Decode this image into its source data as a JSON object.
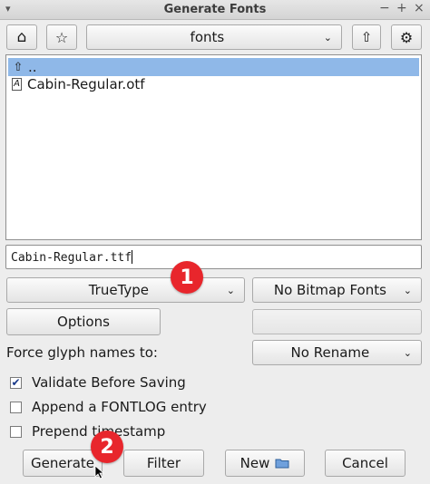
{
  "window": {
    "title": "Generate Fonts",
    "menu_glyph": "▾",
    "min_glyph": "−",
    "max_glyph": "+",
    "close_glyph": "×"
  },
  "toolbar": {
    "home_icon": "⌂",
    "star_icon": "☆",
    "folder_combo": "fonts",
    "up_icon": "⇧",
    "gear_icon": "⚙"
  },
  "files": [
    {
      "icon": "⇧",
      "name": "..",
      "selected": true
    },
    {
      "icon": "A",
      "name": "Cabin-Regular.otf",
      "selected": false
    }
  ],
  "filename_value": "Cabin-Regular.ttf",
  "format_combo": "TrueType",
  "bitmap_combo": "No Bitmap Fonts",
  "options_button": "Options",
  "force_label": "Force glyph names to:",
  "rename_combo": "No Rename",
  "checkboxes": [
    {
      "label": "Validate Before Saving",
      "checked": true,
      "mark": "✔"
    },
    {
      "label": "Append a FONTLOG entry",
      "checked": false,
      "mark": ""
    },
    {
      "label": "Prepend timestamp",
      "checked": false,
      "mark": ""
    }
  ],
  "buttons": {
    "generate": "Generate",
    "filter": "Filter",
    "new": "New",
    "cancel": "Cancel"
  },
  "annotations": [
    "1",
    "2"
  ],
  "arrow_glyph": "⌄"
}
